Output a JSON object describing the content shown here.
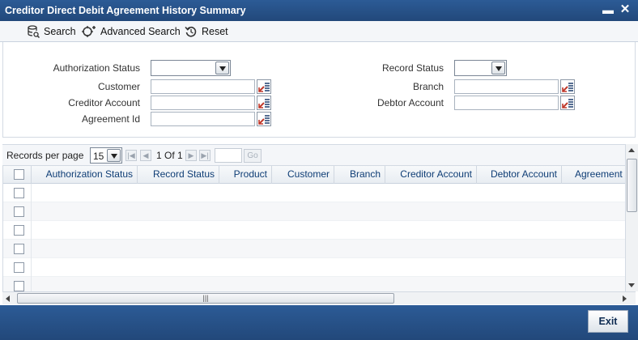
{
  "window": {
    "title": "Creditor Direct Debit Agreement History Summary"
  },
  "toolbar": {
    "search_label": "Search",
    "advanced_search_label": "Advanced Search",
    "reset_label": "Reset"
  },
  "criteria": {
    "authorization_status": {
      "label": "Authorization Status",
      "value": ""
    },
    "record_status": {
      "label": "Record Status",
      "value": ""
    },
    "customer": {
      "label": "Customer",
      "value": ""
    },
    "branch": {
      "label": "Branch",
      "value": ""
    },
    "creditor_account": {
      "label": "Creditor Account",
      "value": ""
    },
    "debtor_account": {
      "label": "Debtor Account",
      "value": ""
    },
    "agreement_id": {
      "label": "Agreement Id",
      "value": ""
    }
  },
  "pager": {
    "records_per_page_label": "Records per page",
    "records_per_page": "15",
    "page_info": "1 Of 1",
    "go_label": "Go"
  },
  "grid": {
    "columns": [
      "Authorization Status",
      "Record Status",
      "Product",
      "Customer",
      "Branch",
      "Creditor Account",
      "Debtor Account",
      "Agreement"
    ]
  },
  "footer": {
    "exit_label": "Exit"
  },
  "colors": {
    "titlebar": "#22487a",
    "header_text": "#0e3d75",
    "lov_icon": "#c0392b"
  },
  "icons": [
    "search-icon",
    "advanced-search-icon",
    "reset-icon",
    "lov-icon",
    "minimize-icon",
    "close-icon"
  ]
}
